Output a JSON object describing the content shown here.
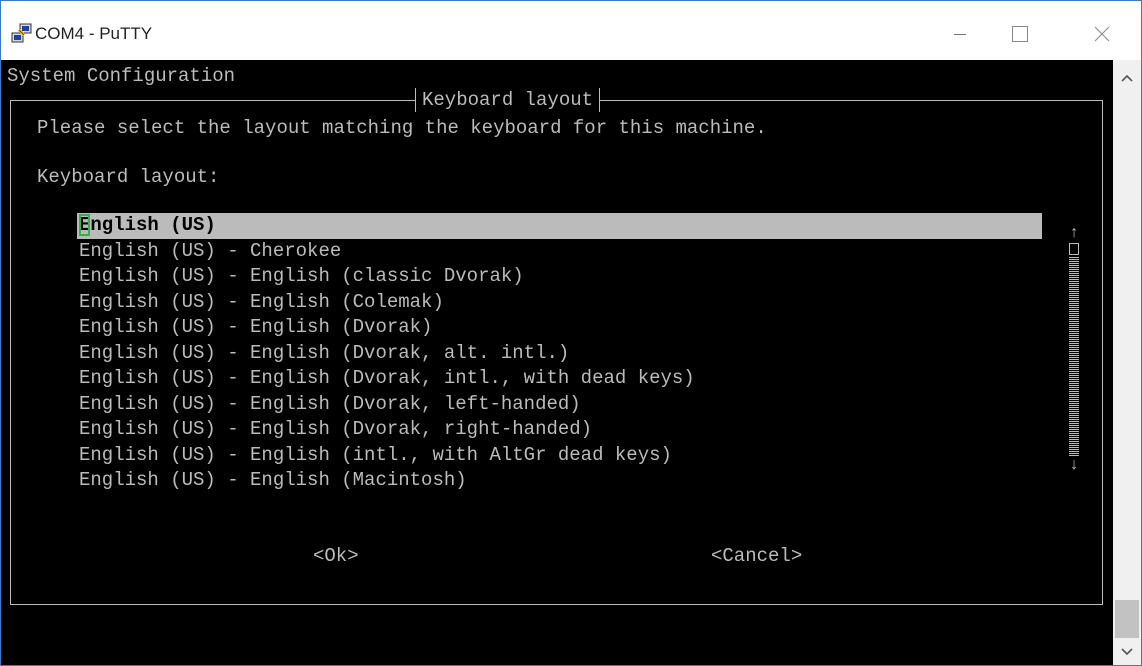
{
  "window": {
    "title": "COM4 - PuTTY",
    "app_icon": "putty-icon",
    "controls": {
      "minimize": "minimize-icon",
      "maximize": "maximize-icon",
      "close": "close-icon"
    }
  },
  "terminal": {
    "screen_title": "System Configuration",
    "dialog": {
      "title": "Keyboard layout",
      "prompt": "Please select the layout matching the keyboard for this machine.",
      "list_label": "Keyboard layout:",
      "items": [
        "English (US)",
        "English (US) - Cherokee",
        "English (US) - English (classic Dvorak)",
        "English (US) - English (Colemak)",
        "English (US) - English (Dvorak)",
        "English (US) - English (Dvorak, alt. intl.)",
        "English (US) - English (Dvorak, intl., with dead keys)",
        "English (US) - English (Dvorak, left-handed)",
        "English (US) - English (Dvorak, right-handed)",
        "English (US) - English (intl., with AltGr dead keys)",
        "English (US) - English (Macintosh)"
      ],
      "selected_index": 0,
      "scroll_up": "↑",
      "scroll_down": "↓",
      "ok_label": "<Ok>",
      "cancel_label": "<Cancel>"
    }
  },
  "colors": {
    "terminal_bg": "#000000",
    "terminal_fg": "#bbbbbb",
    "selection_bg": "#bbbbbb",
    "cursor": "#2fb34a",
    "window_border": "#3c78c8"
  }
}
